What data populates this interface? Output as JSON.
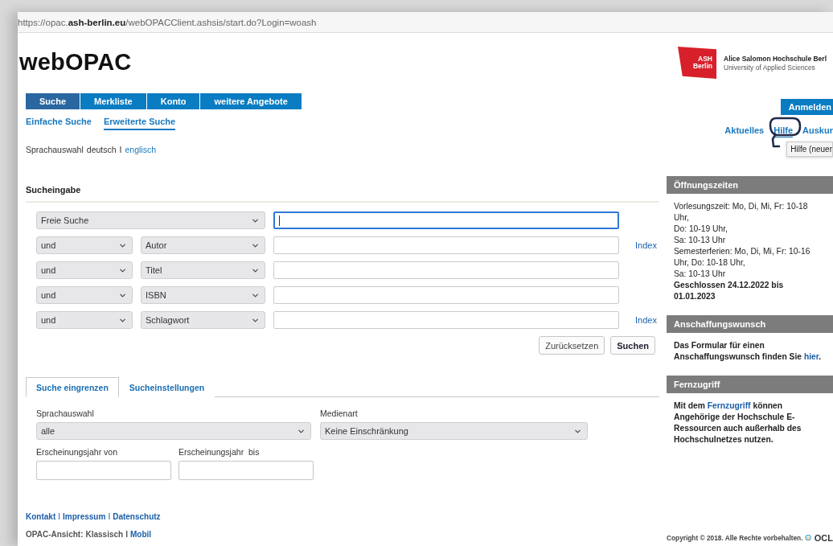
{
  "url": "https://opac.**ash-berlin.eu**/webOPACClient.ashsis/start.do?Login=woash",
  "title": "webOPAC",
  "nav": [
    {
      "label": "Suche",
      "selected": true
    },
    {
      "label": "Merkliste",
      "selected": false
    },
    {
      "label": "Konto",
      "selected": false
    },
    {
      "label": "weitere Angebote",
      "selected": false
    }
  ],
  "subnav": [
    {
      "label": "Einfache Suche",
      "selected": false
    },
    {
      "label": "Erweiterte Suche",
      "selected": true
    }
  ],
  "language": {
    "label": "Sprachauswahl",
    "separator": "I",
    "options": [
      {
        "label": "deutsch",
        "selected": true
      },
      {
        "label": "englisch",
        "selected": false
      }
    ]
  },
  "search": {
    "heading": "Sucheingabe",
    "rows": [
      {
        "field": "Freie Suche",
        "focused": true
      },
      {
        "operator": "und",
        "field": "Autor",
        "index": "Index",
        "focused": false
      },
      {
        "operator": "und",
        "field": "Titel",
        "focused": false
      },
      {
        "operator": "und",
        "field": "ISBN",
        "focused": false
      },
      {
        "operator": "und",
        "field": "Schlagwort",
        "index": "Index",
        "focused": false
      }
    ],
    "buttons": [
      {
        "label": "Zurücksetzen",
        "kind": "secondary"
      },
      {
        "label": "Suchen",
        "kind": "primary"
      }
    ]
  },
  "filter_tabs": [
    {
      "label": "Suche eingrenzen",
      "selected": true
    },
    {
      "label": "Sucheinstellungen",
      "selected": false
    }
  ],
  "filters": {
    "selects": [
      {
        "label": "Sprachauswahl",
        "value": "alle"
      },
      {
        "label": "Medienart",
        "value": "Keine Einschränkung"
      }
    ],
    "year_fields": [
      {
        "label": "Erscheinungsjahr von"
      },
      {
        "label": "Erscheinungsjahr  bis"
      }
    ]
  },
  "footer": {
    "links": [
      {
        "label": "Kontakt",
        "kind": "link"
      },
      {
        "label": "I",
        "kind": "separator"
      },
      {
        "label": "Impressum",
        "kind": "link"
      },
      {
        "label": "I",
        "kind": "separator"
      },
      {
        "label": "Datenschutz",
        "kind": "link"
      }
    ],
    "view_label": "OPAC-Ansicht:",
    "view_separator": "I",
    "view_options": [
      {
        "label": "Klassisch",
        "selected": true
      },
      {
        "label": "Mobil",
        "selected": false
      }
    ]
  },
  "institution": {
    "mark": [
      "ASH",
      "Berlin"
    ],
    "name": "Alice Salomon Hochschule Berl",
    "subtitle": "University of Applied Sciences"
  },
  "login_button": "Anmelden",
  "top_links": [
    {
      "label": "Aktuelles",
      "highlighted": false
    },
    {
      "label": "Hilfe",
      "highlighted": true
    },
    {
      "label": "Auskur",
      "highlighted": false
    }
  ],
  "tooltip": "Hilfe (neuer",
  "sidebar": [
    {
      "title": "Öffnungszeiten",
      "paragraphs": [
        {
          "text": "Vorlesungszeit: Mo, Di, Mi, Fr: 10-18 Uhr,",
          "bold": false
        },
        {
          "text": "Do: 10-19 Uhr,",
          "bold": false
        },
        {
          "text": "Sa: 10-13 Uhr",
          "bold": false
        },
        {
          "text": "Semesterferien: Mo, Di, Mi, Fr: 10-16 Uhr, Do: 10-18 Uhr,",
          "bold": false
        },
        {
          "text": "Sa: 10-13 Uhr",
          "bold": false
        },
        {
          "text": "Geschlossen 24.12.2022 bis 01.01.2023",
          "bold": true
        }
      ]
    },
    {
      "title": "Anschaffungswunsch",
      "paragraphs": [
        {
          "text": "Das Formular für einen Anschaffungswunsch finden Sie ",
          "link": "hier",
          "after": ".",
          "bold": true
        }
      ]
    },
    {
      "title": "Fernzugriff",
      "paragraphs": [
        {
          "text": "Mit dem ",
          "link": "Fernzugriff",
          "after": " können Angehörige der Hochschule E-Ressourcen auch außerhalb des Hochschulnetzes nutzen.",
          "bold": true
        }
      ]
    }
  ],
  "copyright": "Copyright © 2018. Alle Rechte vorbehalten.",
  "vendor": "OCL"
}
